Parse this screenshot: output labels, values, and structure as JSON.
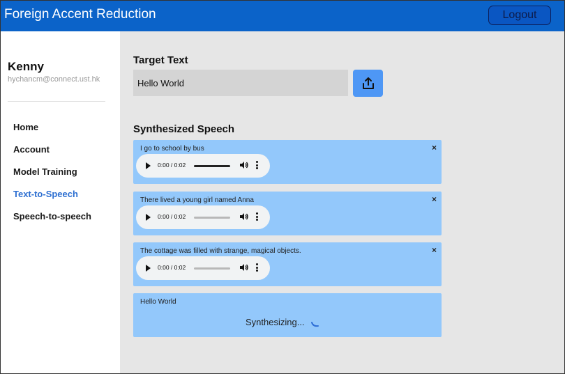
{
  "header": {
    "title": "Foreign Accent Reduction",
    "logout_label": "Logout"
  },
  "user": {
    "name": "Kenny",
    "email": "hychancm@connect.ust.hk"
  },
  "sidebar": {
    "items": [
      {
        "label": "Home",
        "active": false
      },
      {
        "label": "Account",
        "active": false
      },
      {
        "label": "Model Training",
        "active": false
      },
      {
        "label": "Text-to-Speech",
        "active": true
      },
      {
        "label": "Speech-to-speech",
        "active": false
      }
    ]
  },
  "target": {
    "heading": "Target Text",
    "value": "Hello World",
    "upload_icon": "upload-icon"
  },
  "synthesized": {
    "heading": "Synthesized Speech",
    "items": [
      {
        "text": "I go to school by bus",
        "close": "×",
        "time": "0:00 / 0:02"
      },
      {
        "text": "There lived a young girl named Anna",
        "close": "×",
        "time": "0:00 / 0:02"
      },
      {
        "text": "The cottage was filled with strange, magical objects.",
        "close": "×",
        "time": "0:00 / 0:02"
      }
    ],
    "pending": {
      "text": "Hello World",
      "status": "Synthesizing..."
    }
  },
  "colors": {
    "header_bg": "#0b63c9",
    "active_nav": "#2d6fd1",
    "card_bg": "#93c8fb",
    "upload_btn": "#4e97f5",
    "main_bg": "#e6e6e6"
  }
}
